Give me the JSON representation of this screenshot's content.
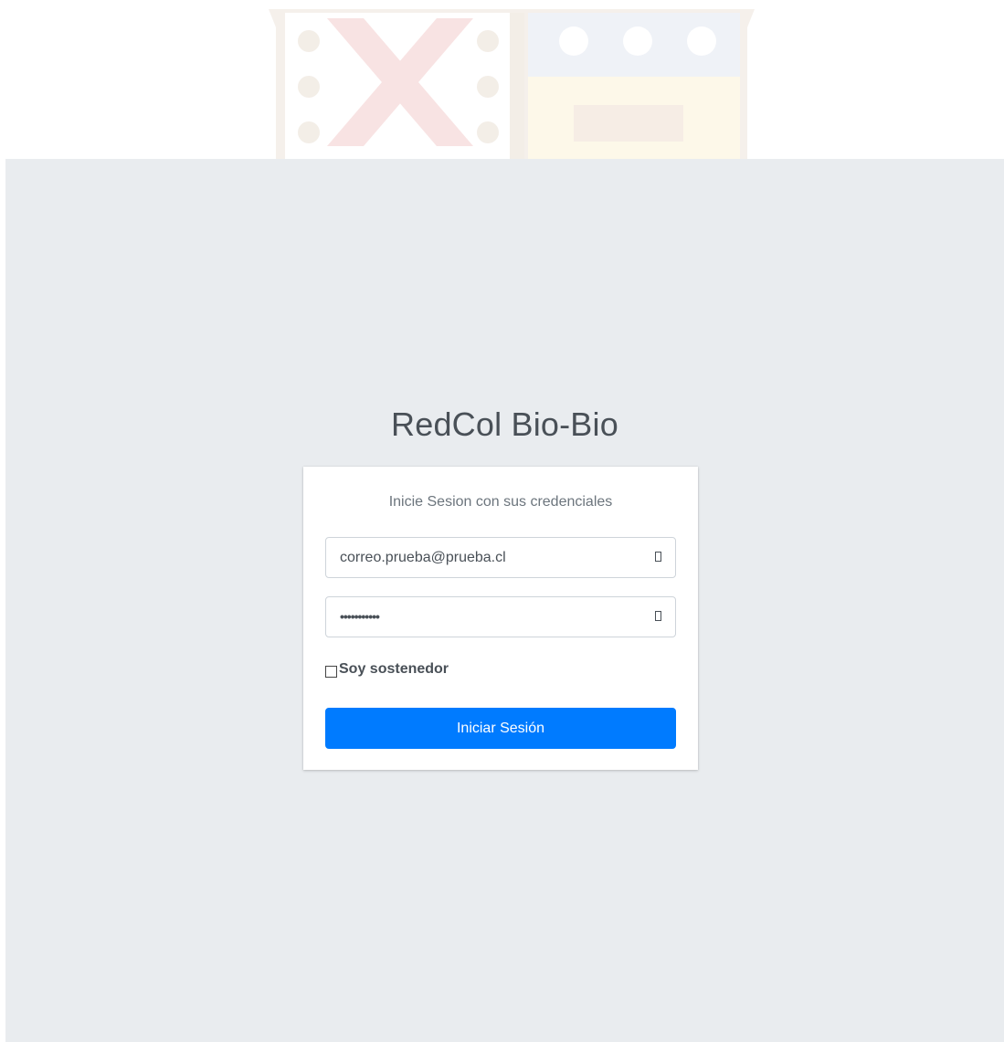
{
  "brand": {
    "title": "RedCol Bio-Bio"
  },
  "login": {
    "message": "Inicie Sesion con sus credenciales",
    "email": {
      "value": "correo.prueba@prueba.cl",
      "icon": "envelope-icon"
    },
    "password": {
      "value": "•••••••••••",
      "icon": "lock-icon"
    },
    "remember_label": "Soy sostenedor",
    "remember_checked": false,
    "submit_label": "Iniciar Sesión"
  },
  "colors": {
    "page_background": "#e9ecef",
    "card_background": "#ffffff",
    "primary": "#007bff",
    "text": "#495057"
  }
}
